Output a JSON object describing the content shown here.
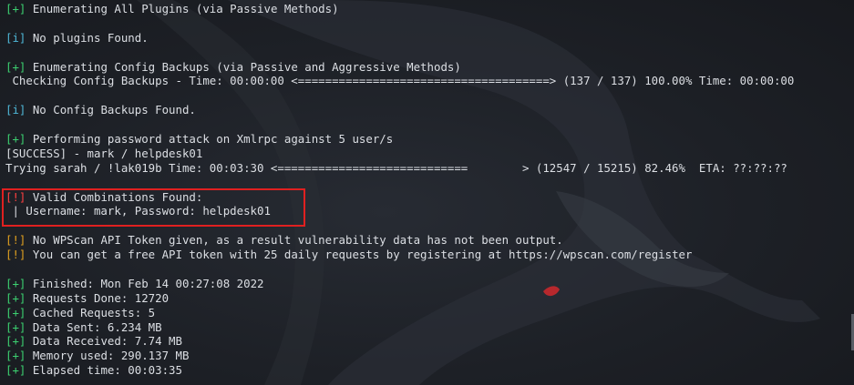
{
  "terminal": {
    "lines": [
      {
        "tag": "[+]",
        "text": " Enumerating All Plugins (via Passive Methods)"
      },
      {
        "tag": "",
        "text": ""
      },
      {
        "tag": "[i]",
        "text": " No plugins Found."
      },
      {
        "tag": "",
        "text": ""
      },
      {
        "tag": "[+]",
        "text": " Enumerating Config Backups (via Passive and Aggressive Methods)"
      },
      {
        "tag": "",
        "text": " Checking Config Backups - Time: 00:00:00 <=====================================> (137 / 137) 100.00% Time: 00:00:00"
      },
      {
        "tag": "",
        "text": ""
      },
      {
        "tag": "[i]",
        "text": " No Config Backups Found."
      },
      {
        "tag": "",
        "text": ""
      },
      {
        "tag": "[+]",
        "text": " Performing password attack on Xmlrpc against 5 user/s"
      },
      {
        "tag": "",
        "text": "[SUCCESS] - mark / helpdesk01"
      },
      {
        "tag": "",
        "text": "Trying sarah / !lak019b Time: 00:03:30 <============================        > (12547 / 15215) 82.46%  ETA: ??:??:??"
      },
      {
        "tag": "",
        "text": ""
      },
      {
        "tag": "[!]",
        "text": " Valid Combinations Found:"
      },
      {
        "tag": "",
        "text": " | Username: mark, Password: helpdesk01"
      },
      {
        "tag": "",
        "text": ""
      },
      {
        "tag": "[!]",
        "text": " No WPScan API Token given, as a result vulnerability data has not been output."
      },
      {
        "tag": "[!]",
        "text": " You can get a free API token with 25 daily requests by registering at https://wpscan.com/register"
      },
      {
        "tag": "",
        "text": ""
      },
      {
        "tag": "[+]",
        "text": " Finished: Mon Feb 14 00:27:08 2022"
      },
      {
        "tag": "[+]",
        "text": " Requests Done: 12720"
      },
      {
        "tag": "[+]",
        "text": " Cached Requests: 5"
      },
      {
        "tag": "[+]",
        "text": " Data Sent: 6.234 MB"
      },
      {
        "tag": "[+]",
        "text": " Data Received: 7.74 MB"
      },
      {
        "tag": "[+]",
        "text": " Memory used: 290.137 MB"
      },
      {
        "tag": "[+]",
        "text": " Elapsed time: 00:03:35"
      }
    ]
  },
  "colors": {
    "background": "#1b1e24",
    "text": "#dcdfe4",
    "tag_plus": "#3cd070",
    "tag_info": "#4fb8d8",
    "tag_warn": "#e0a020",
    "tag_alert": "#ff4040",
    "highlight_border": "#e02020"
  },
  "icons": {
    "watermark": "kali-dragon-icon"
  }
}
